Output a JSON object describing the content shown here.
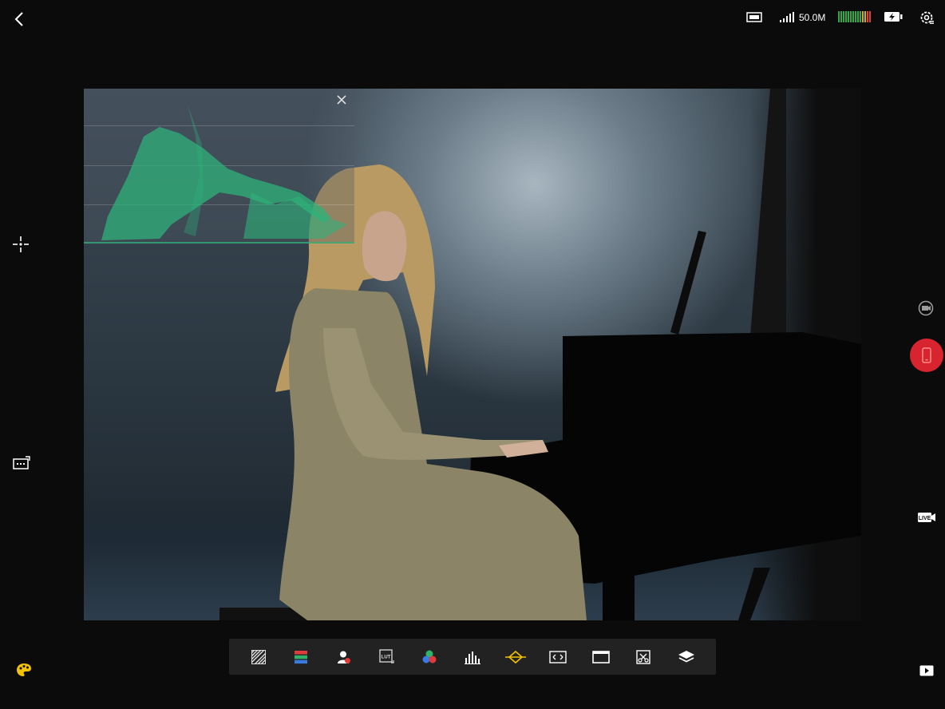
{
  "status_bar": {
    "signal_value": "50.0M"
  },
  "icons": {
    "back": "chevron-left-icon",
    "monitor": "monitor-icon",
    "signal": "signal-bars-icon",
    "audio_meter": "audio-level-meter-icon",
    "battery": "battery-charging-icon",
    "settings": "gear-settings-icon",
    "focus_peaking": "crosshair-icon",
    "aspect_ratio": "aspect-ratio-icon",
    "palette": "palette-icon",
    "camera_switch": "camera-switch-icon",
    "record": "record-phone-icon",
    "live": "live-stream-icon",
    "play": "play-icon"
  },
  "toolbar": {
    "tools": [
      {
        "name": "zebra-tool",
        "icon": "zebra-stripes-icon"
      },
      {
        "name": "false-color-tool",
        "icon": "false-color-icon"
      },
      {
        "name": "skin-tone-tool",
        "icon": "person-icon"
      },
      {
        "name": "lut-tool",
        "label": "LUT",
        "icon": "lut-icon"
      },
      {
        "name": "color-channels-tool",
        "icon": "rgb-circles-icon"
      },
      {
        "name": "histogram-tool",
        "icon": "histogram-icon"
      },
      {
        "name": "waveform-tool",
        "icon": "waveform-icon"
      },
      {
        "name": "frame-guide-tool",
        "icon": "frame-guide-icon"
      },
      {
        "name": "letterbox-tool",
        "icon": "letterbox-icon"
      },
      {
        "name": "anamorphic-tool",
        "icon": "desqueeze-icon"
      },
      {
        "name": "layers-tool",
        "icon": "layers-icon"
      }
    ]
  },
  "colors": {
    "accent_active": "#f2c200",
    "record_red": "#d8242f",
    "waveform_green": "#2fb27a",
    "meter_green": "#2faa4a",
    "meter_red": "#e0403a"
  }
}
